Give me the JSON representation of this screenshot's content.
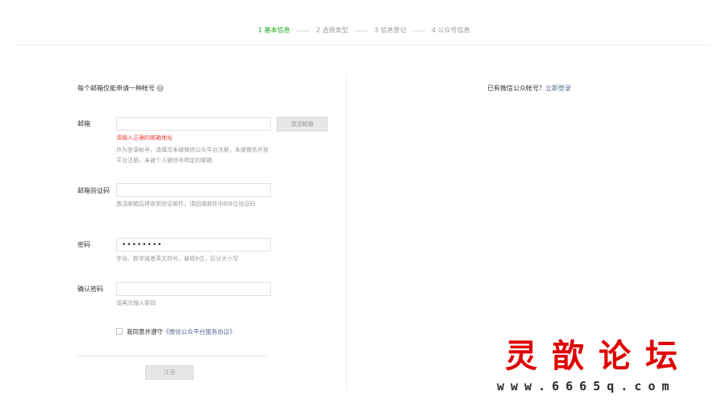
{
  "steps": [
    {
      "label": "1 基本信息",
      "active": true
    },
    {
      "label": "2 选择类型",
      "active": false
    },
    {
      "label": "3 信息登记",
      "active": false
    },
    {
      "label": "4 公众号信息",
      "active": false
    }
  ],
  "hint": "每个邮箱仅能申请一种帐号",
  "help_icon": "?",
  "email": {
    "label": "邮箱",
    "value": "",
    "activate_button": "激活邮箱",
    "error": "请输入正确的邮箱地址",
    "tip": "作为登录帐号，请填写未被微信公众平台注册，未被微信开放平台注册，未被个人微信号绑定的邮箱"
  },
  "code": {
    "label": "邮箱验证码",
    "value": "",
    "tip": "激活邮箱后将收到验证邮件，请回填邮件中的6位验证码"
  },
  "password": {
    "label": "密码",
    "value": "••••••••",
    "tip": "字母、数字或者英文符号，最短8位，区分大小写"
  },
  "confirm": {
    "label": "确认密码",
    "value": "",
    "tip": "请再次输入密码"
  },
  "agree": {
    "prefix": "我同意并遵守",
    "link": "《微信公众平台服务协议》",
    "checked": false
  },
  "register_button": "注册",
  "login": {
    "prefix": "已有微信公众帐号？",
    "link": "立即登录"
  },
  "watermark": {
    "title": "灵歆论坛",
    "url": "www.6665q.com"
  },
  "colors": {
    "active_step": "#1aad19",
    "link": "#576b95",
    "error": "#e64340",
    "watermark": "#e00000"
  }
}
